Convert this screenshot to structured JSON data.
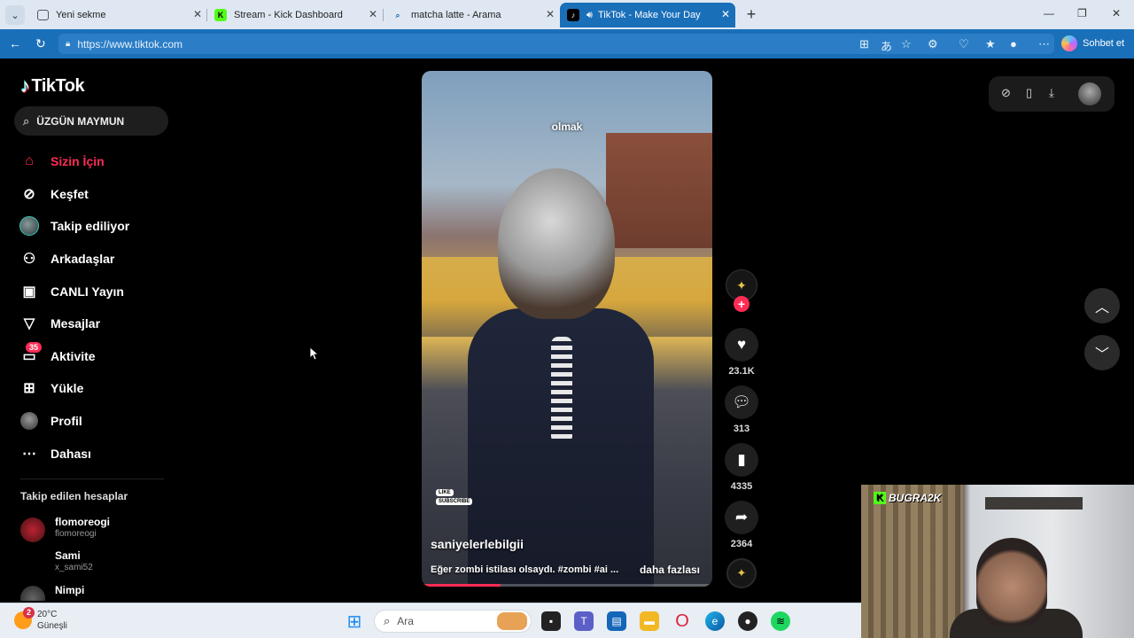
{
  "browser": {
    "tabs": [
      {
        "title": "Yeni sekme",
        "favicon": "new-tab-icon",
        "active": false
      },
      {
        "title": "Stream - Kick Dashboard",
        "favicon": "kick-icon",
        "active": false
      },
      {
        "title": "matcha latte - Arama",
        "favicon": "search-icon",
        "active": false
      },
      {
        "title": "TikTok - Make Your Day",
        "favicon": "tiktok-icon",
        "active": true
      }
    ],
    "url": "https://www.tiktok.com",
    "copilot_label": "Sohbet et",
    "accent": "#1a6fb9"
  },
  "tiktok": {
    "logo_text": "TikTok",
    "search_value": "ÜZGÜN MAYMUN",
    "nav": [
      {
        "label": "Sizin İçin",
        "icon": "home-icon",
        "active": true
      },
      {
        "label": "Keşfet",
        "icon": "compass-icon"
      },
      {
        "label": "Takip ediliyor",
        "icon": "following-avatar-icon"
      },
      {
        "label": "Arkadaşlar",
        "icon": "friends-icon"
      },
      {
        "label": "CANLI Yayın",
        "icon": "live-icon"
      },
      {
        "label": "Mesajlar",
        "icon": "message-icon"
      },
      {
        "label": "Aktivite",
        "icon": "activity-icon",
        "badge": "35"
      },
      {
        "label": "Yükle",
        "icon": "upload-icon"
      },
      {
        "label": "Profil",
        "icon": "profile-avatar-icon"
      },
      {
        "label": "Dahası",
        "icon": "more-icon"
      }
    ],
    "following_title": "Takip edilen hesaplar",
    "following": [
      {
        "name": "flomoreogi",
        "handle": "flomoreogi"
      },
      {
        "name": "Sami",
        "handle": "x_sami52"
      },
      {
        "name": "Nimpi",
        "handle": ""
      }
    ],
    "video": {
      "caption_overlay": "olmak",
      "sub_like": "LIKE",
      "sub_subscribe": "SUBSCRIBE",
      "author": "saniyelerlebilgii",
      "description": "Eğer zombi istilası olsaydı. #zombi #ai ...",
      "more_label": "daha fazlası",
      "progress": 0.27
    },
    "actions": {
      "likes": "23.1K",
      "comments": "313",
      "saves": "4335",
      "shares": "2364"
    },
    "brand_color": "#fe2c55"
  },
  "webcam": {
    "label": "BUGRA2K"
  },
  "taskbar": {
    "temperature": "20°C",
    "weather": "Güneşli",
    "weather_badge": "2",
    "search_placeholder": "Ara"
  }
}
